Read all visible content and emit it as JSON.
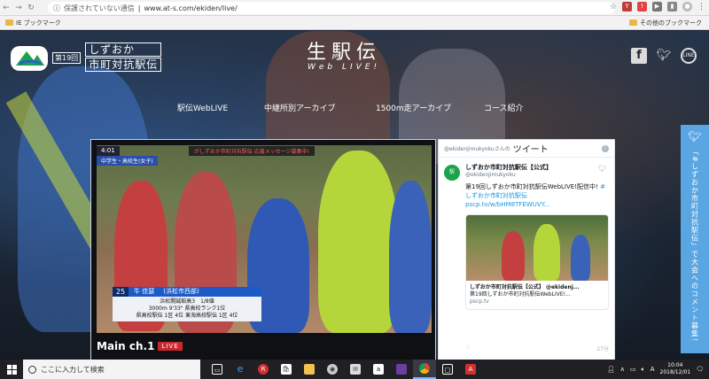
{
  "browser": {
    "security_label": "保護されていない通信",
    "url": "www.at-s.com/ekiden/live/",
    "bookmarks_left": "IE ブックマーク",
    "bookmarks_right": "その他のブックマーク"
  },
  "site": {
    "logo_number": "第19回",
    "logo_line1": "しずおか",
    "logo_line2": "市町対抗駅伝",
    "brand_title": "生駅伝",
    "brand_sub": "Web LIVE!",
    "nav": [
      {
        "label": "駅伝WebLIVE"
      },
      {
        "label": "中継所別アーカイブ"
      },
      {
        "label": "1500m走アーカイブ"
      },
      {
        "label": "コース紹介"
      }
    ]
  },
  "player": {
    "clock": "4:01",
    "category": "中学生・高校生(女子)",
    "message_band": "がしずおか市町対抗駅伝 応援メッセージ募集中!",
    "bib_number": "25",
    "runner_name": "牛 佳瑟",
    "runner_team": "(浜松市西部)",
    "runner_info": [
      "浜松開誠館高3　1/8値",
      "3000m 9'33\" 県高校ランク1位",
      "県高校駅伝 1区 4位 東海高校駅伝 1区 4位"
    ],
    "channel_label": "Main ch.1",
    "live_label": "LIVE"
  },
  "tweets": {
    "handle_prefix": "@ekidenjimukyokuさんの",
    "title": "ツイート",
    "name": "しずおか市町対抗駅伝【公式】",
    "handle": "@ekidenjimukyoku",
    "text": "第19回しずおか市町対抗駅伝WebLIVE!配信中!",
    "hashtag": "#しずおか市町対抗駅伝",
    "link": "pscp.tv/w/bHM8TFEWUVY...",
    "card_title": "しずおか市町対抗駅伝【公式】 @ekidenj...",
    "card_desc": "第19回しずおか市町対抗駅伝WebLIVE!...",
    "card_domain": "pscp.tv",
    "time": "27分"
  },
  "side_banner": {
    "text": "「#しずおか市町対抗駅伝」で大会へのコメント募集!"
  },
  "taskbar": {
    "search_placeholder": "ここに入力して検索",
    "time": "10:04",
    "date": "2018/12/01"
  },
  "colors": {
    "live_red": "#c9282d",
    "banner_blue": "#5aa6e3",
    "twitter_link": "#1b95e0"
  }
}
